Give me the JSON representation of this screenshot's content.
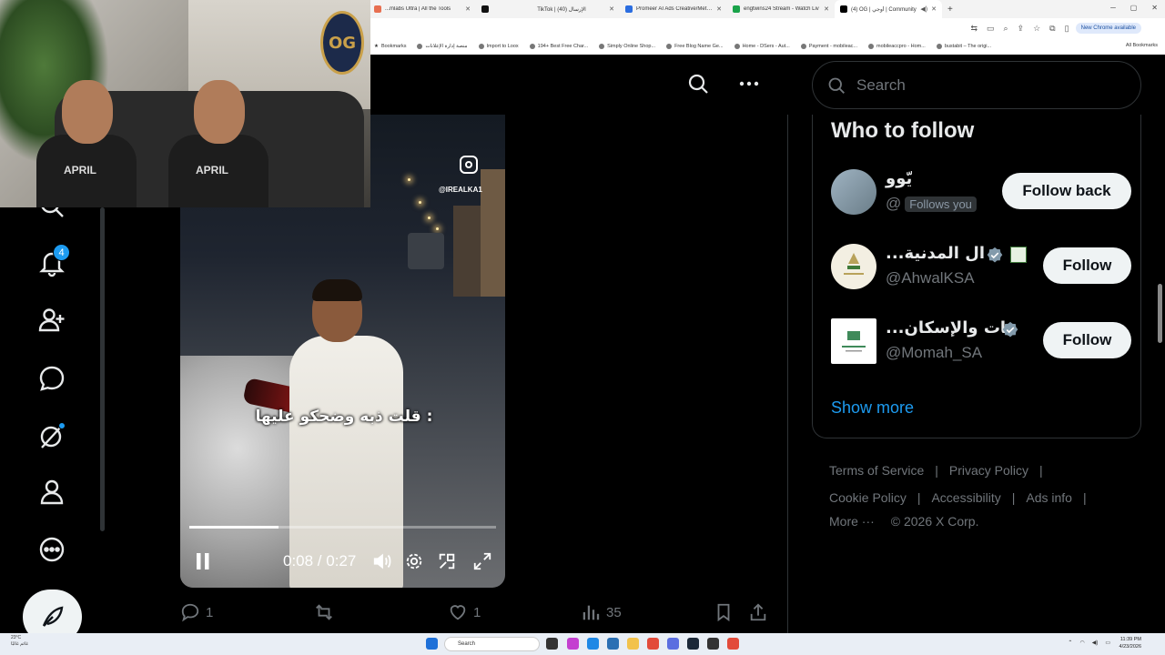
{
  "browser": {
    "tabs": [
      {
        "label": "...mlabs Ultra | All the Tools",
        "color": "#e76f51"
      },
      {
        "label": "",
        "color": "#111111"
      },
      {
        "label": "TikTok | الإرسال (40)",
        "color": "#111111"
      },
      {
        "label": "Promeer AI Ads Creative/Meta A",
        "color": "#2b6de0"
      },
      {
        "label": "engtwins24 Stream - Watch Liv",
        "color": "#1aa34a"
      },
      {
        "label": "(4) OG | أوجي | Community",
        "color": "#000000",
        "active": true
      }
    ],
    "new_chrome_label": "New Chrome available",
    "bookmarks": [
      "Bookmarks",
      "منصة إدارة الإعلانات",
      "Import to Loox",
      "194+ Best Free Char...",
      "Simply Online Shop...",
      "Free Blog Name Ge...",
      "Home - DSers - Aut...",
      "Payment - mobileac...",
      "mobileaccpro - Hom...",
      "bustabit – The origi..."
    ],
    "all_bookmarks_label": "All Bookmarks"
  },
  "webcam": {
    "logo_text": "OG",
    "shirt_text_left": "APRIL",
    "shirt_text_right": "APRIL"
  },
  "nav": {
    "notifications_badge": "4"
  },
  "video": {
    "instagram_handle": "@IREALKA1",
    "subtitle": "قلت ذبه وضحكو عليها :",
    "time": "0:08 / 0:27",
    "progress": 0.29
  },
  "actions": {
    "replies": "1",
    "likes": "1",
    "views": "35"
  },
  "search": {
    "placeholder": "Search"
  },
  "who_to_follow": {
    "title": "Who to follow",
    "users": [
      {
        "name": "يّوو",
        "handle": "@",
        "follows_you": "Follows you",
        "button": "Follow back"
      },
      {
        "name": "...ال المدنية",
        "handle": "@AhwalKSA",
        "button": "Follow"
      },
      {
        "name": "...يات والإسكان",
        "handle": "@Momah_SA",
        "button": "Follow"
      }
    ],
    "show_more": "Show more"
  },
  "footer": {
    "terms": "Terms of Service",
    "privacy": "Privacy Policy",
    "cookie": "Cookie Policy",
    "accessibility": "Accessibility",
    "ads_info": "Ads info",
    "more": "More ···",
    "copyright": "© 2026 X Corp."
  },
  "taskbar": {
    "weather_temp": "23°C",
    "weather_desc": "غائم غالبًا",
    "search_label": "Search",
    "time": "11:39 PM",
    "date": "4/23/2026"
  }
}
